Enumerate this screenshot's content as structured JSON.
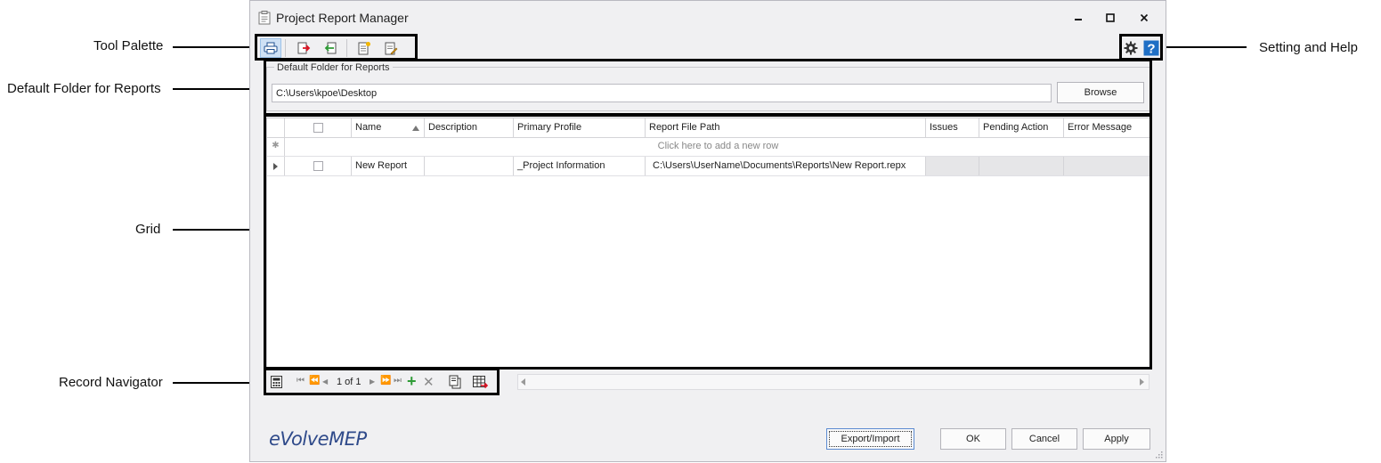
{
  "window": {
    "title": "Project Report Manager",
    "minimize_glyph": "🗕",
    "maximize_glyph": "☐",
    "close_glyph": "✕"
  },
  "callouts": {
    "tool_palette": "Tool Palette",
    "default_folder": "Default Folder for Reports",
    "grid": "Grid",
    "record_navigator": "Record Navigator",
    "setting_and_help": "Setting and Help"
  },
  "toolbar": {
    "buttons": [
      "print-icon",
      "export-report-icon",
      "import-report-icon",
      "new-report-icon",
      "edit-report-icon"
    ],
    "settings_icon": "gear-icon",
    "help_icon": "help-icon",
    "help_glyph": "?"
  },
  "default_folder": {
    "group_title": "Default Folder for Reports",
    "path_value": "C:\\Users\\kpoe\\Desktop",
    "browse_label": "Browse"
  },
  "grid": {
    "columns": [
      "",
      "Name",
      "Description",
      "Primary Profile",
      "Report File Path",
      "Issues",
      "Pending Action",
      "Error Message"
    ],
    "sorted_column": "Name",
    "new_row_hint": "Click here to add a new row",
    "rows": [
      {
        "checked": false,
        "name": "New Report",
        "description": "",
        "primary_profile": "_Project Information",
        "report_file_path": "C:\\Users\\UserName\\Documents\\Reports\\New Report.repx",
        "issues": "",
        "pending_action": "",
        "error_message": ""
      }
    ]
  },
  "navigator": {
    "record_text": "1 of 1",
    "first_glyph": "⏮",
    "prev_page_glyph": "⏪",
    "prev_glyph": "◀",
    "next_glyph": "▶",
    "next_page_glyph": "⏩",
    "last_glyph": "⏭",
    "add_glyph": "+",
    "delete_glyph": "✕"
  },
  "footer": {
    "logo_text": "eVolveMEP",
    "export_import_label": "Export/Import",
    "ok_label": "OK",
    "cancel_label": "Cancel",
    "apply_label": "Apply"
  },
  "colors": {
    "accent": "#2f4a8a",
    "help_blue": "#1f6fc5",
    "add_green": "#2e9b36",
    "delete_grey": "#8a8a8a"
  }
}
